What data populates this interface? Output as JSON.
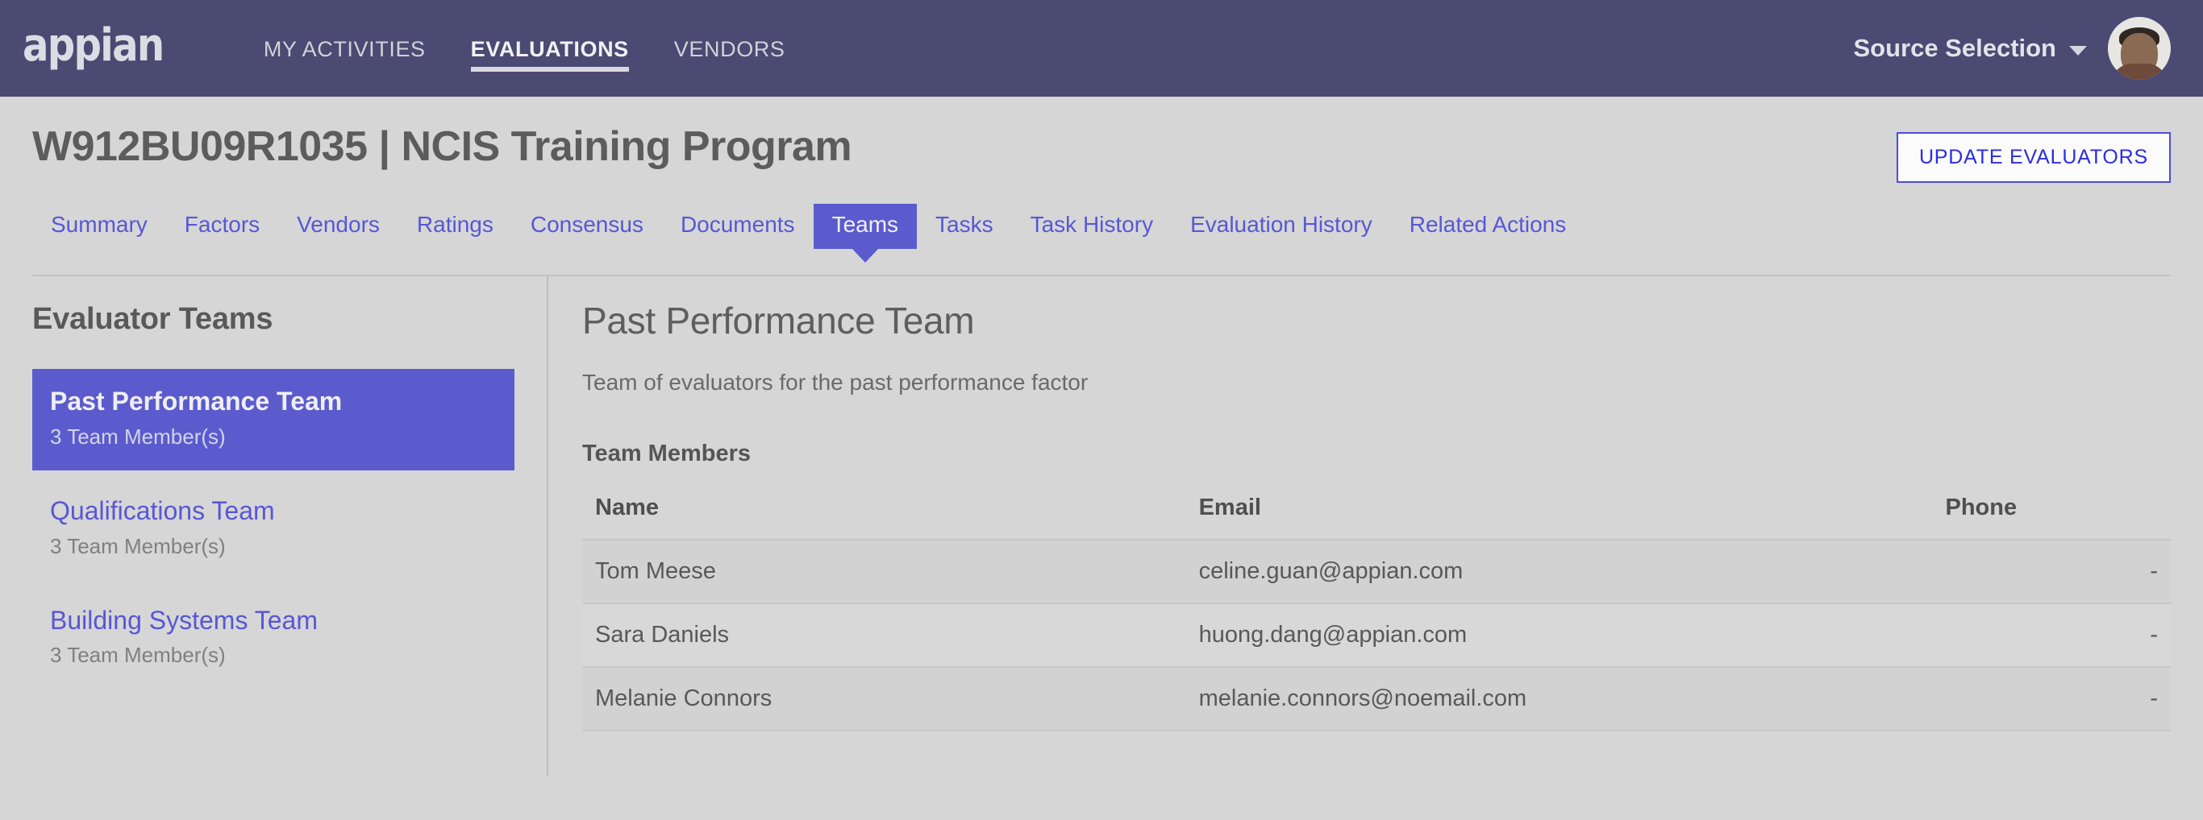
{
  "brand": {
    "logo_text": "appian"
  },
  "topnav": {
    "items": [
      {
        "label": "MY ACTIVITIES",
        "active": false
      },
      {
        "label": "EVALUATIONS",
        "active": true
      },
      {
        "label": "VENDORS",
        "active": false
      }
    ],
    "user_menu_label": "Source Selection",
    "caret_icon": "chevron-down-icon",
    "avatar_icon": "user-avatar-photo"
  },
  "page": {
    "title": "W912BU09R1035 | NCIS Training Program",
    "update_button_label": "UPDATE EVALUATORS"
  },
  "tabs": [
    {
      "label": "Summary",
      "active": false
    },
    {
      "label": "Factors",
      "active": false
    },
    {
      "label": "Vendors",
      "active": false
    },
    {
      "label": "Ratings",
      "active": false
    },
    {
      "label": "Consensus",
      "active": false
    },
    {
      "label": "Documents",
      "active": false
    },
    {
      "label": "Teams",
      "active": true
    },
    {
      "label": "Tasks",
      "active": false
    },
    {
      "label": "Task History",
      "active": false
    },
    {
      "label": "Evaluation History",
      "active": false
    },
    {
      "label": "Related Actions",
      "active": false
    }
  ],
  "sidebar": {
    "title": "Evaluator Teams",
    "teams": [
      {
        "name": "Past Performance Team",
        "count": "3 Team Member(s)",
        "selected": true
      },
      {
        "name": "Qualifications Team",
        "count": "3 Team Member(s)",
        "selected": false
      },
      {
        "name": "Building Systems Team",
        "count": "3 Team Member(s)",
        "selected": false
      }
    ]
  },
  "main": {
    "title": "Past Performance Team",
    "description": "Team of evaluators for the past performance factor",
    "section_label": "Team Members",
    "table": {
      "columns": [
        "Name",
        "Email",
        "Phone"
      ],
      "rows": [
        {
          "name": "Tom Meese",
          "email": "celine.guan@appian.com",
          "phone": "-"
        },
        {
          "name": "Sara Daniels",
          "email": "huong.dang@appian.com",
          "phone": "-"
        },
        {
          "name": "Melanie Connors",
          "email": "melanie.connors@noemail.com",
          "phone": "-"
        }
      ]
    }
  },
  "colors": {
    "header_bg": "#4a4a72",
    "accent_purple": "#5b5bce",
    "link_purple": "#5757d6",
    "page_bg": "#d6d6d6",
    "button_blue": "#2d2de0"
  }
}
